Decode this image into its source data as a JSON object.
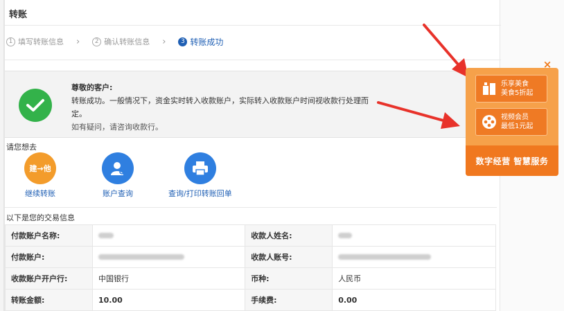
{
  "page": {
    "title": "转账"
  },
  "steps": [
    {
      "num": "1",
      "label": "填写转账信息"
    },
    {
      "num": "2",
      "label": "确认转账信息"
    },
    {
      "num": "3",
      "label": "转账成功"
    }
  ],
  "success": {
    "greeting": "尊敬的客户:",
    "message": "转账成功。一般情况下，资金实时转入收款账户，实际转入收款账户时间视收款行处理而定。",
    "help": "如有疑问，请咨询收款行。"
  },
  "actions": {
    "heading": "请您想去",
    "items": [
      {
        "label": "继续转账",
        "icon_text": "建→他"
      },
      {
        "label": "账户查询"
      },
      {
        "label": "查询/打印转账回单"
      }
    ]
  },
  "transaction": {
    "heading": "以下是您的交易信息",
    "rows": [
      {
        "k1": "付款账户名称:",
        "v1": "",
        "k2": "收款人姓名:",
        "v2": ""
      },
      {
        "k1": "付款账户:",
        "v1": "",
        "k2": "收款人账号:",
        "v2": ""
      },
      {
        "k1": "收款账户开户行:",
        "v1": "中国银行",
        "k2": "币种:",
        "v2": "人民币"
      },
      {
        "k1": "转账金额:",
        "v1": "10.00",
        "k2": "手续费:",
        "v2": "0.00"
      }
    ]
  },
  "promo": {
    "close": "×",
    "card1": {
      "line1": "乐享美食",
      "line2": "美食5折起"
    },
    "card2": {
      "line1": "视频会员",
      "line2": "最低1元起"
    },
    "banner": "数字经营 智慧服务"
  },
  "colors": {
    "primary": "#1f5fb4",
    "success": "#33b24a",
    "accent": "#f0781f",
    "amount": "#d6271f"
  }
}
